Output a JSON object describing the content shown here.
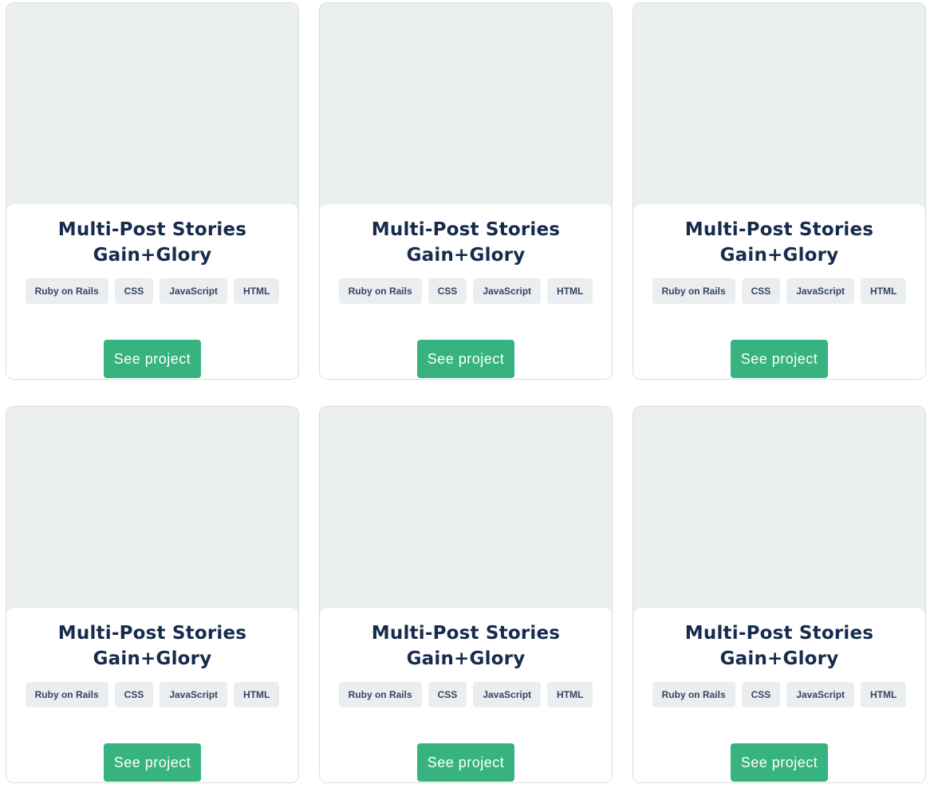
{
  "projects": [
    {
      "title": "Multi-Post Stories Gain+Glory",
      "tags": [
        "Ruby on Rails",
        "CSS",
        "JavaScript",
        "HTML"
      ],
      "button_label": "See project"
    },
    {
      "title": "Multi-Post Stories Gain+Glory",
      "tags": [
        "Ruby on Rails",
        "CSS",
        "JavaScript",
        "HTML"
      ],
      "button_label": "See project"
    },
    {
      "title": "Multi-Post Stories Gain+Glory",
      "tags": [
        "Ruby on Rails",
        "CSS",
        "JavaScript",
        "HTML"
      ],
      "button_label": "See project"
    },
    {
      "title": "Multi-Post Stories Gain+Glory",
      "tags": [
        "Ruby on Rails",
        "CSS",
        "JavaScript",
        "HTML"
      ],
      "button_label": "See project"
    },
    {
      "title": "Multi-Post Stories Gain+Glory",
      "tags": [
        "Ruby on Rails",
        "CSS",
        "JavaScript",
        "HTML"
      ],
      "button_label": "See project"
    },
    {
      "title": "Multi-Post Stories Gain+Glory",
      "tags": [
        "Ruby on Rails",
        "CSS",
        "JavaScript",
        "HTML"
      ],
      "button_label": "See project"
    }
  ],
  "colors": {
    "title": "#172b4d",
    "button_bg": "#36b37e",
    "image_placeholder": "#ebefee",
    "tag_bg": "#ebeef0"
  }
}
